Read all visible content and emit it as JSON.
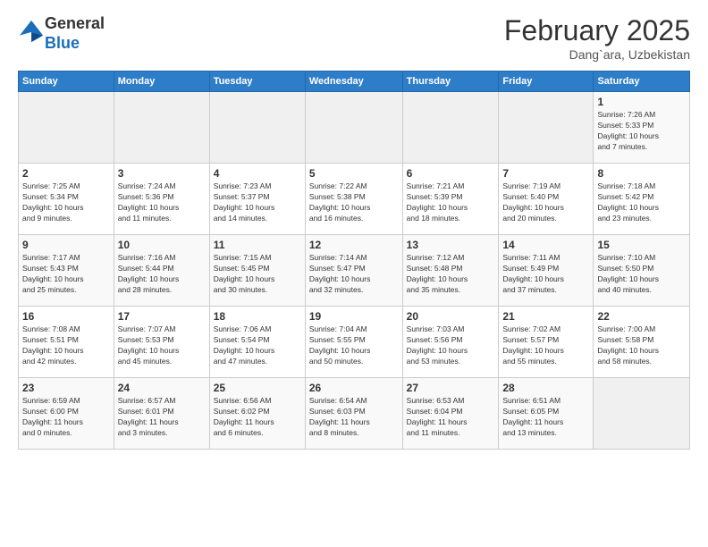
{
  "logo": {
    "general": "General",
    "blue": "Blue"
  },
  "title": {
    "month_year": "February 2025",
    "location": "Dang`ara, Uzbekistan"
  },
  "weekdays": [
    "Sunday",
    "Monday",
    "Tuesday",
    "Wednesday",
    "Thursday",
    "Friday",
    "Saturday"
  ],
  "weeks": [
    [
      {
        "day": "",
        "info": ""
      },
      {
        "day": "",
        "info": ""
      },
      {
        "day": "",
        "info": ""
      },
      {
        "day": "",
        "info": ""
      },
      {
        "day": "",
        "info": ""
      },
      {
        "day": "",
        "info": ""
      },
      {
        "day": "1",
        "info": "Sunrise: 7:26 AM\nSunset: 5:33 PM\nDaylight: 10 hours\nand 7 minutes."
      }
    ],
    [
      {
        "day": "2",
        "info": "Sunrise: 7:25 AM\nSunset: 5:34 PM\nDaylight: 10 hours\nand 9 minutes."
      },
      {
        "day": "3",
        "info": "Sunrise: 7:24 AM\nSunset: 5:36 PM\nDaylight: 10 hours\nand 11 minutes."
      },
      {
        "day": "4",
        "info": "Sunrise: 7:23 AM\nSunset: 5:37 PM\nDaylight: 10 hours\nand 14 minutes."
      },
      {
        "day": "5",
        "info": "Sunrise: 7:22 AM\nSunset: 5:38 PM\nDaylight: 10 hours\nand 16 minutes."
      },
      {
        "day": "6",
        "info": "Sunrise: 7:21 AM\nSunset: 5:39 PM\nDaylight: 10 hours\nand 18 minutes."
      },
      {
        "day": "7",
        "info": "Sunrise: 7:19 AM\nSunset: 5:40 PM\nDaylight: 10 hours\nand 20 minutes."
      },
      {
        "day": "8",
        "info": "Sunrise: 7:18 AM\nSunset: 5:42 PM\nDaylight: 10 hours\nand 23 minutes."
      }
    ],
    [
      {
        "day": "9",
        "info": "Sunrise: 7:17 AM\nSunset: 5:43 PM\nDaylight: 10 hours\nand 25 minutes."
      },
      {
        "day": "10",
        "info": "Sunrise: 7:16 AM\nSunset: 5:44 PM\nDaylight: 10 hours\nand 28 minutes."
      },
      {
        "day": "11",
        "info": "Sunrise: 7:15 AM\nSunset: 5:45 PM\nDaylight: 10 hours\nand 30 minutes."
      },
      {
        "day": "12",
        "info": "Sunrise: 7:14 AM\nSunset: 5:47 PM\nDaylight: 10 hours\nand 32 minutes."
      },
      {
        "day": "13",
        "info": "Sunrise: 7:12 AM\nSunset: 5:48 PM\nDaylight: 10 hours\nand 35 minutes."
      },
      {
        "day": "14",
        "info": "Sunrise: 7:11 AM\nSunset: 5:49 PM\nDaylight: 10 hours\nand 37 minutes."
      },
      {
        "day": "15",
        "info": "Sunrise: 7:10 AM\nSunset: 5:50 PM\nDaylight: 10 hours\nand 40 minutes."
      }
    ],
    [
      {
        "day": "16",
        "info": "Sunrise: 7:08 AM\nSunset: 5:51 PM\nDaylight: 10 hours\nand 42 minutes."
      },
      {
        "day": "17",
        "info": "Sunrise: 7:07 AM\nSunset: 5:53 PM\nDaylight: 10 hours\nand 45 minutes."
      },
      {
        "day": "18",
        "info": "Sunrise: 7:06 AM\nSunset: 5:54 PM\nDaylight: 10 hours\nand 47 minutes."
      },
      {
        "day": "19",
        "info": "Sunrise: 7:04 AM\nSunset: 5:55 PM\nDaylight: 10 hours\nand 50 minutes."
      },
      {
        "day": "20",
        "info": "Sunrise: 7:03 AM\nSunset: 5:56 PM\nDaylight: 10 hours\nand 53 minutes."
      },
      {
        "day": "21",
        "info": "Sunrise: 7:02 AM\nSunset: 5:57 PM\nDaylight: 10 hours\nand 55 minutes."
      },
      {
        "day": "22",
        "info": "Sunrise: 7:00 AM\nSunset: 5:58 PM\nDaylight: 10 hours\nand 58 minutes."
      }
    ],
    [
      {
        "day": "23",
        "info": "Sunrise: 6:59 AM\nSunset: 6:00 PM\nDaylight: 11 hours\nand 0 minutes."
      },
      {
        "day": "24",
        "info": "Sunrise: 6:57 AM\nSunset: 6:01 PM\nDaylight: 11 hours\nand 3 minutes."
      },
      {
        "day": "25",
        "info": "Sunrise: 6:56 AM\nSunset: 6:02 PM\nDaylight: 11 hours\nand 6 minutes."
      },
      {
        "day": "26",
        "info": "Sunrise: 6:54 AM\nSunset: 6:03 PM\nDaylight: 11 hours\nand 8 minutes."
      },
      {
        "day": "27",
        "info": "Sunrise: 6:53 AM\nSunset: 6:04 PM\nDaylight: 11 hours\nand 11 minutes."
      },
      {
        "day": "28",
        "info": "Sunrise: 6:51 AM\nSunset: 6:05 PM\nDaylight: 11 hours\nand 13 minutes."
      },
      {
        "day": "",
        "info": ""
      }
    ]
  ]
}
